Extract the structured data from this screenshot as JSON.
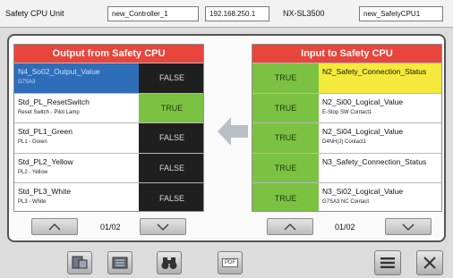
{
  "header": {
    "unit_label": "Safety CPU Unit",
    "controller_name": "new_Controller_1",
    "ip_address": "192.168.250.1",
    "model": "NX-SL3500",
    "cpu_name": "new_SafetyCPU1"
  },
  "output_panel": {
    "title": "Output from Safety CPU",
    "rows": [
      {
        "name": "N4_So02_Output_Value",
        "sub": "G7SA3",
        "value": "FALSE"
      },
      {
        "name": "Std_PL_ResetSwitch",
        "sub": "Reset Switch - Pilot Lamp",
        "value": "TRUE"
      },
      {
        "name": "Std_PL1_Green",
        "sub": "PL1 - Green",
        "value": "FALSE"
      },
      {
        "name": "Std_PL2_Yellow",
        "sub": "PL2 - Yellow",
        "value": "FALSE"
      },
      {
        "name": "Std_PL3_White",
        "sub": "PL3 - White",
        "value": "FALSE"
      }
    ],
    "page": "01/02"
  },
  "input_panel": {
    "title": "Input to Safety CPU",
    "rows": [
      {
        "name": "N2_Safety_Connection_Status",
        "sub": "",
        "value": "TRUE"
      },
      {
        "name": "N2_Si00_Logical_Value",
        "sub": "E-Stop SW Contact1",
        "value": "TRUE"
      },
      {
        "name": "N2_Si04_Logical_Value",
        "sub": "D4NH(J) Contact1",
        "value": "TRUE"
      },
      {
        "name": "N3_Safety_Connection_Status",
        "sub": "",
        "value": "TRUE"
      },
      {
        "name": "N3_Si02_Logical_Value",
        "sub": "G7SA3 NC Contact",
        "value": "TRUE"
      }
    ],
    "page": "01/02"
  },
  "toolbar": {
    "icons": [
      "monitor-icon",
      "list-icon",
      "binoculars-icon",
      "pdf-icon",
      "menu-icon",
      "close-icon"
    ],
    "pdf_label": "PDF"
  },
  "colors": {
    "panel_header": "#e8453c",
    "true_bg": "#7cc242",
    "false_bg": "#1f1f1f",
    "selected": "#2e6db8",
    "highlight": "#f5ea3b"
  }
}
